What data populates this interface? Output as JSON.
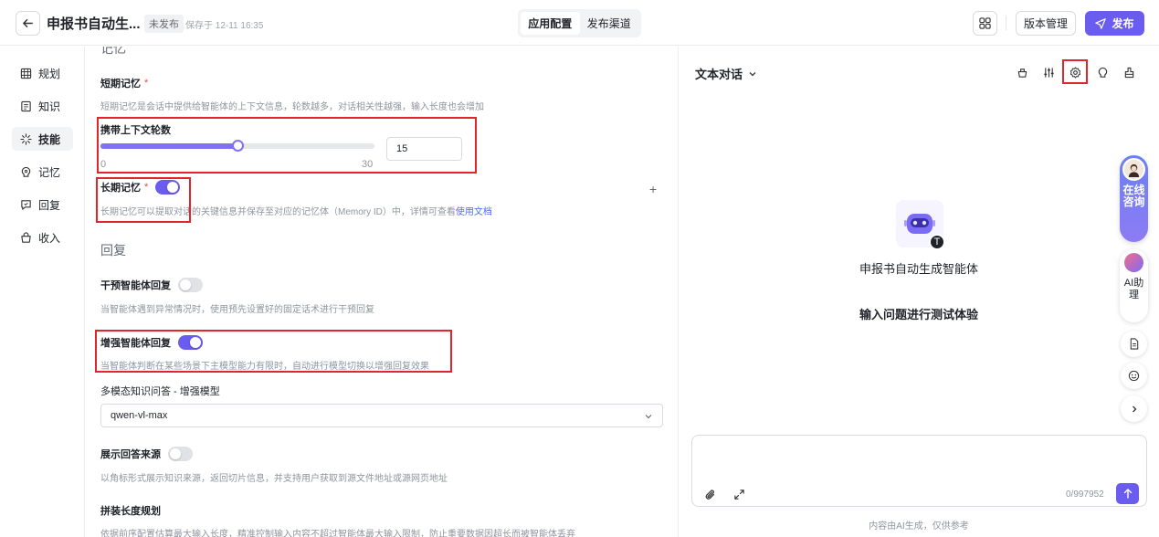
{
  "header": {
    "title": "申报书自动生...",
    "status": "未发布",
    "save_time": "保存于 12-11 16:35",
    "tabs": [
      {
        "label": "应用配置",
        "active": true
      },
      {
        "label": "发布渠道",
        "active": false
      }
    ],
    "version_label": "版本管理",
    "publish_label": "发布"
  },
  "sidebar": {
    "items": [
      {
        "label": "规划",
        "icon": "planning-icon"
      },
      {
        "label": "知识",
        "icon": "knowledge-icon"
      },
      {
        "label": "技能",
        "icon": "skills-icon",
        "active": true
      },
      {
        "label": "记忆",
        "icon": "memory-icon"
      },
      {
        "label": "回复",
        "icon": "reply-icon"
      },
      {
        "label": "收入",
        "icon": "income-icon"
      }
    ]
  },
  "config": {
    "section_memory": "记忆",
    "short_memory": {
      "label": "短期记忆",
      "required": "*",
      "desc": "短期记忆是会话中提供给智能体的上下文信息，轮数越多，对话相关性越强，输入长度也会增加",
      "rounds_label": "携带上下文轮数",
      "slider_min": "0",
      "slider_max": "30",
      "value": "15",
      "value_fraction": 0.5
    },
    "long_memory": {
      "label": "长期记忆",
      "required": "*",
      "enabled": true,
      "desc": "长期记忆可以提取对话的关键信息并保存至对应的记忆体（Memory ID）中，详情可查看",
      "doc_link": "使用文档"
    },
    "section_reply": "回复",
    "intervene": {
      "label": "干预智能体回复",
      "enabled": false,
      "desc": "当智能体遇到异常情况时，使用预先设置好的固定话术进行干预回复"
    },
    "enhance": {
      "label": "增强智能体回复",
      "enabled": true,
      "desc": "当智能体判断在某些场景下主模型能力有限时，自动进行模型切换以增强回复效果"
    },
    "multimodal": {
      "label": "多模态知识问答 - 增强模型",
      "selected": "qwen-vl-max"
    },
    "source": {
      "label": "展示回答来源",
      "enabled": false,
      "desc": "以角标形式展示知识来源，返回切片信息，并支持用户获取到源文件地址或源网页地址"
    },
    "length_plan": {
      "label": "拼装长度规划",
      "desc": "依据前序配置估算最大输入长度，精准控制输入内容不超过智能体最大输入限制，防止重要数据因超长而被智能体丢弃"
    }
  },
  "preview": {
    "mode": "文本对话",
    "agent_name": "申报书自动生成智能体",
    "avatar_badge": "T",
    "hint": "输入问题进行测试体验",
    "char_count": "0/997952",
    "disclaimer": "内容由AI生成，仅供参考"
  },
  "float": {
    "consult_text": "在线咨询",
    "ai_text": "AI助理"
  },
  "colors": {
    "accent": "#6b5cf0",
    "highlight_box": "#e0262c"
  }
}
